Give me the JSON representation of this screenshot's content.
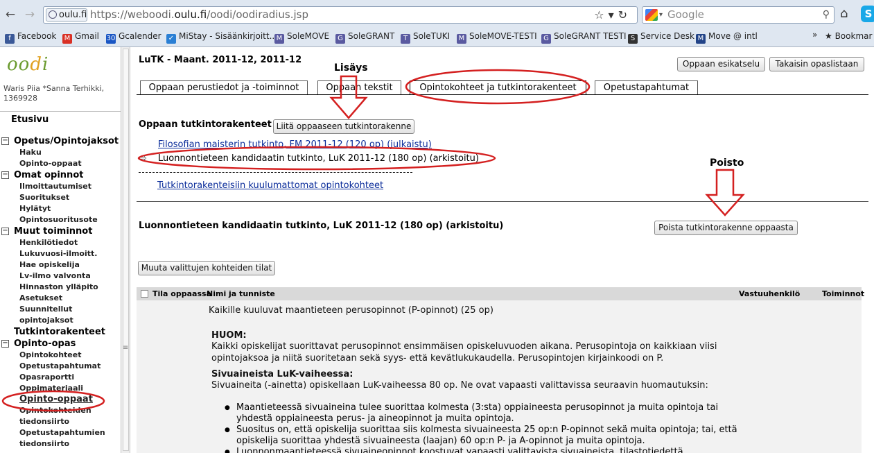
{
  "browser": {
    "url_site": "oulu.fi",
    "url_prefix": "https://weboodi.",
    "url_domain": "oulu.fi",
    "url_path": "/oodi/oodiradius.jsp",
    "search_placeholder": "Google"
  },
  "bookmarks": [
    {
      "label": "Facebook",
      "icon": "facebook-icon",
      "color": "#3b5998",
      "glyph": "f"
    },
    {
      "label": "Gmail",
      "icon": "gmail-icon",
      "color": "#d93025",
      "glyph": "M"
    },
    {
      "label": "Gcalender",
      "icon": "calendar-icon",
      "color": "#1a56c4",
      "glyph": "30"
    },
    {
      "label": "MiStay - Sisäänkirjoitt...",
      "icon": "mistay-icon",
      "color": "#2a7fd4",
      "glyph": "✓"
    },
    {
      "label": "SoleMOVE",
      "icon": "solemove-icon",
      "color": "#5a5aa0",
      "glyph": "M"
    },
    {
      "label": "SoleGRANT",
      "icon": "solegrant-icon",
      "color": "#5a5aa0",
      "glyph": "G"
    },
    {
      "label": "SoleTUKI",
      "icon": "soletuki-icon",
      "color": "#5a5aa0",
      "glyph": "T"
    },
    {
      "label": "SoleMOVE-TESTI",
      "icon": "solemove-testi-icon",
      "color": "#5a5aa0",
      "glyph": "M"
    },
    {
      "label": "SoleGRANT TESTI",
      "icon": "solegrant-testi-icon",
      "color": "#5a5aa0",
      "glyph": "G"
    },
    {
      "label": "Service Desk",
      "icon": "service-desk-icon",
      "color": "#333333",
      "glyph": "S"
    },
    {
      "label": "Move @ intl",
      "icon": "move-intl-icon",
      "color": "#224488",
      "glyph": "M"
    }
  ],
  "bookmarks_more": "»",
  "bookmarks_folder": "Bookmar",
  "sidebar": {
    "user": "Waris Piia *Sanna Terhikki, 1369928",
    "etusivu": "Etusivu",
    "groups": [
      {
        "label": "Opetus/Opintojaksot",
        "items": [
          "Haku",
          "Opinto-oppaat"
        ]
      },
      {
        "label": "Omat opinnot",
        "items": [
          "Ilmoittautumiset",
          "Suoritukset",
          "Hylätyt",
          "Opintosuoritusote"
        ]
      },
      {
        "label": "Muut toiminnot",
        "items": [
          "Henkilötiedot",
          "Lukuvuosi-ilmoitt.",
          "Hae opiskelija",
          "Lv-ilmo valvonta",
          "Hinnaston ylläpito",
          "Asetukset",
          "Suunnitellut",
          "opintojaksot"
        ]
      }
    ],
    "tutkintorakenteet": "Tutkintorakenteet",
    "opas_group": "Opinto-opas",
    "opas_items": [
      "Opintokohteet",
      "Opetustapahtumat",
      "Opasraportti",
      "Oppimateriaali"
    ],
    "opas_selected": "Opinto-oppaat",
    "opas_items_after": [
      "Opintokohteiden",
      "tiedonsiirto",
      "Opetustapahtumien",
      "tiedonsiirto"
    ]
  },
  "main": {
    "title": "LuTK - Maant. 2011-12, 2011-12",
    "btn_preview": "Oppaan esikatselu",
    "btn_back": "Takaisin opaslistaan",
    "tabs": [
      "Oppaan perustiedot ja -toiminnot",
      "Oppaan tekstit",
      "Opintokohteet ja tutkintorakenteet",
      "Opetustapahtumat"
    ],
    "annot_add": "Lisäys",
    "annot_remove": "Poisto",
    "section_title": "Oppaan tutkintorakenteet",
    "btn_attach": "Liitä oppaaseen tutkintorakenne",
    "structure_link_1": "Filosofian maisterin tutkinto, FM 2011-12 (120 op) (julkaistu)",
    "structure_current": "Luonnontieteen kandidaatin tutkinto, LuK 2011-12 (180 op) (arkistoitu)",
    "structure_other": "Tutkintorakenteisiin kuulumattomat opintokohteet",
    "selected_title": "Luonnontieteen kandidaatin tutkinto, LuK 2011-12 (180 op) (arkistoitu)",
    "btn_remove": "Poista tutkintorakenne oppaasta",
    "btn_change": "Muuta valittujen kohteiden tilat",
    "col_status": "Tila oppaassa",
    "col_name": "Nimi ja tunniste",
    "col_resp": "Vastuuhenkilö",
    "col_actions": "Toiminnot",
    "row_title": "Kaikille kuuluvat maantieteen perusopinnot (P-opinnot) (25 op)",
    "huom_head": "HUOM:",
    "huom_l1": "Kaikki opiskelijat suorittavat perusopinnot ensimmäisen opiskeluvuoden aikana. Perusopintoja on kaikkiaan viisi",
    "huom_l2": "opintojaksoa ja niitä suoritetaan sekä syys- että kevätlukukaudella. Perusopintojen kirjainkoodi on P.",
    "sivu_head": "Sivuaineista LuK-vaiheessa:",
    "sivu_l1": "Sivuaineita (-ainetta) opiskellaan LuK-vaiheessa 80 op. Ne ovat vapaasti valittavissa seuraavin huomautuksin:",
    "bullets": [
      "Maantieteessä sivuaineina tulee suorittaa kolmesta (3:sta) oppiaineesta perusopinnot ja muita opintoja tai yhdestä oppiaineesta perus- ja aineopinnot ja muita opintoja.",
      "Suositus on, että opiskelija suorittaa siis kolmesta sivuaineesta 25 op:n P-opinnot sekä muita opintoja; tai, että opiskelija suorittaa yhdestä sivuaineesta (laajan) 60 op:n P- ja A-opinnot ja muita opintoja.",
      "Luonnonmaantieteessä sivuaineopinnot koostuvat vapaasti valittavista sivuaineista, tilastotiedettä"
    ]
  },
  "colors": {
    "annotation": "#d42020",
    "link": "#0a2c9a"
  }
}
